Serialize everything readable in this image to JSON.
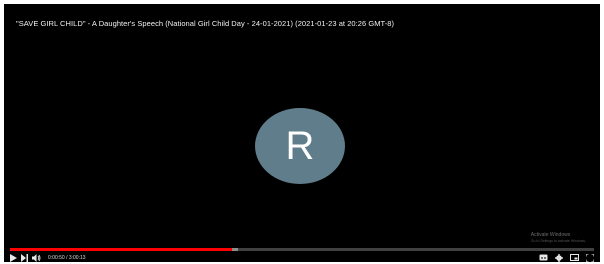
{
  "video": {
    "title": "\"SAVE GIRL CHILD\" - A Daughter's Speech (National Girl Child Day - 24-01-2021) (2021-01-23 at 20:26 GMT-8)",
    "avatar_letter": "R",
    "avatar_color": "#607d8b",
    "background_color": "#000000"
  },
  "watermark": {
    "line1": "Activate Windows",
    "line2": "Go to Settings to activate Windows."
  },
  "player": {
    "progress_played": 0.38,
    "progress_buffered": 0.39,
    "played_color": "#ff0000",
    "time_display": "0:00:50 / 3:00:13",
    "icons": {
      "play": "play-icon",
      "next": "next-icon",
      "volume": "volume-icon",
      "subtitles": "subtitles-icon",
      "settings": "gear-icon",
      "miniplayer": "miniplayer-icon",
      "fullscreen": "fullscreen-icon"
    }
  }
}
